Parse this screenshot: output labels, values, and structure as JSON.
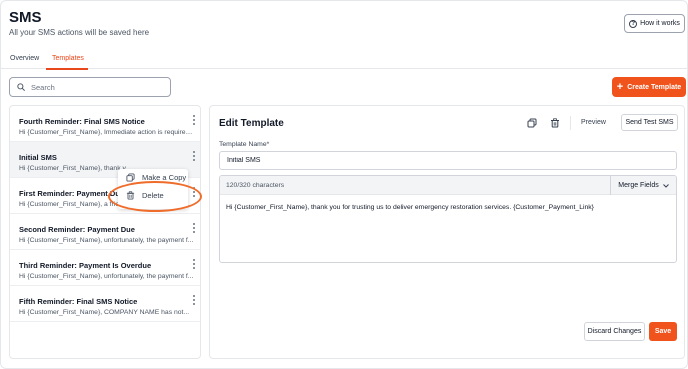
{
  "header": {
    "title": "SMS",
    "subtitle": "All your SMS actions will be saved here",
    "how_it_works": "How it works"
  },
  "tabs": [
    {
      "label": "Overview",
      "active": false
    },
    {
      "label": "Templates",
      "active": true
    }
  ],
  "search": {
    "placeholder": "Search",
    "value": ""
  },
  "create_button": "Create Template",
  "templates": [
    {
      "title": "Fourth Reminder: Final SMS Notice",
      "preview": "Hi {Customer_First_Name}, Immediate action is required..."
    },
    {
      "title": "Initial SMS",
      "preview": "Hi {Customer_First_Name}, thank y"
    },
    {
      "title": "First Reminder: Payment Due",
      "preview": "Hi {Customer_First_Name}, a friendly reminder regardin..."
    },
    {
      "title": "Second Reminder: Payment Due",
      "preview": "Hi {Customer_First_Name}, unfortunately, the payment f..."
    },
    {
      "title": "Third Reminder: Payment Is Overdue",
      "preview": "Hi {Customer_First_Name}, unfortunately, the payment f..."
    },
    {
      "title": "Fifth Reminder: Final SMS Notice",
      "preview": "Hi {Customer_First_Name}, COMPANY NAME has not..."
    }
  ],
  "context_menu": {
    "make_copy": "Make a Copy",
    "delete": "Delete"
  },
  "editor": {
    "title": "Edit Template",
    "preview_label": "Preview",
    "send_test_label": "Send Test SMS",
    "name_label": "Template Name*",
    "name_value": "Initial SMS",
    "char_count": "120/320 characters",
    "merge_fields_label": "Merge Fields",
    "body": "Hi {Customer_First_Name}, thank you for trusting us to deliver emergency restoration services.  {Customer_Payment_Link}",
    "discard_label": "Discard Changes",
    "save_label": "Save"
  },
  "colors": {
    "accent": "#f0531c",
    "highlight_ring": "#ef6c2a"
  }
}
